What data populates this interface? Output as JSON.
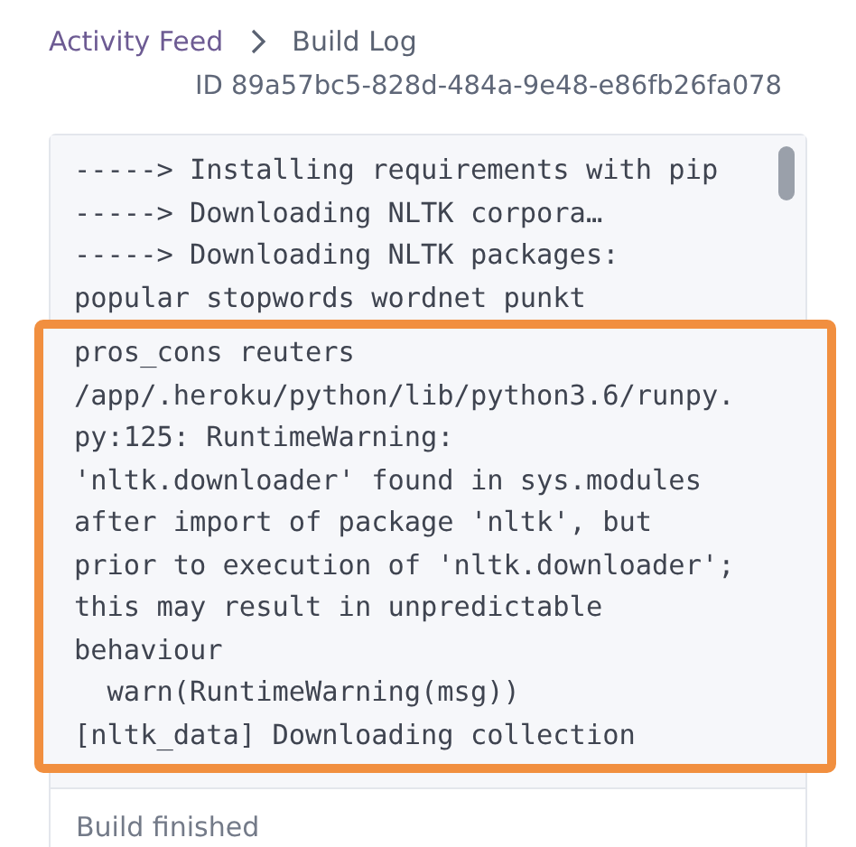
{
  "breadcrumb": [
    {
      "label": "Activity Feed",
      "kind": "link"
    },
    {
      "label": "Build Log",
      "kind": "current"
    }
  ],
  "build_id": "ID 89a57bc5-828d-484a-9e48-e86fb26fa078",
  "log": {
    "lines": [
      "-----> Installing requirements with pip",
      "-----> Downloading NLTK corpora…",
      "-----> Downloading NLTK packages:",
      "popular stopwords wordnet punkt"
    ],
    "highlighted_lines": [
      "pros_cons reuters",
      "/app/.heroku/python/lib/python3.6/runpy.",
      "py:125: RuntimeWarning:",
      "'nltk.downloader' found in sys.modules",
      "after import of package 'nltk', but",
      "prior to execution of 'nltk.downloader';",
      "this may result in unpredictable",
      "behaviour",
      "  warn(RuntimeWarning(msg))",
      "[nltk_data] Downloading collection"
    ]
  },
  "status": "Build finished"
}
